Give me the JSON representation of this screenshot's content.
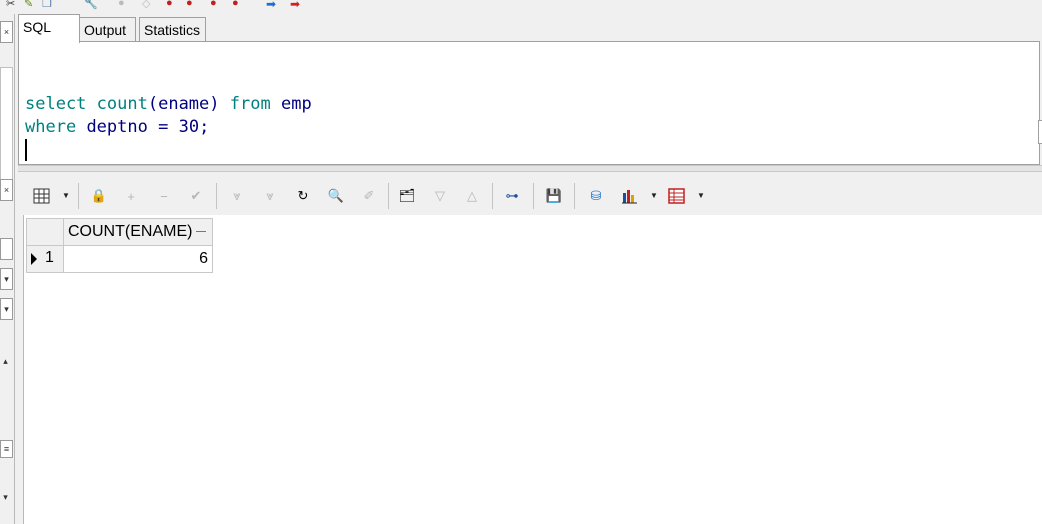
{
  "tabs": [
    {
      "label": "SQL",
      "active": true
    },
    {
      "label": "Output",
      "active": false
    },
    {
      "label": "Statistics",
      "active": false
    }
  ],
  "editor": {
    "line1": {
      "kw1": "select",
      "fn": "count",
      "arg": "(ename)",
      "kw2": "from",
      "table": "emp"
    },
    "line2": {
      "kw1": "where",
      "col": "deptno",
      "op": "=",
      "num": "30",
      "end": ";"
    }
  },
  "grid": {
    "columns": [
      "COUNT(ENAME)"
    ],
    "rows": [
      {
        "row_num": "1",
        "values": [
          "6"
        ]
      }
    ]
  },
  "icons": {
    "grid_toolbar": [
      "grid-view-icon",
      "lock-icon",
      "add-record-icon",
      "delete-record-icon",
      "post-edit-icon",
      "first-record-icon",
      "last-record-icon",
      "refresh-icon",
      "find-icon",
      "clear-icon",
      "query-by-example-icon",
      "sort-desc-icon",
      "sort-asc-icon",
      "tree-icon",
      "save-icon",
      "export-icon",
      "chart-icon",
      "table-icon"
    ]
  },
  "colors": {
    "keyword": "#008080",
    "identifier": "#000080"
  }
}
